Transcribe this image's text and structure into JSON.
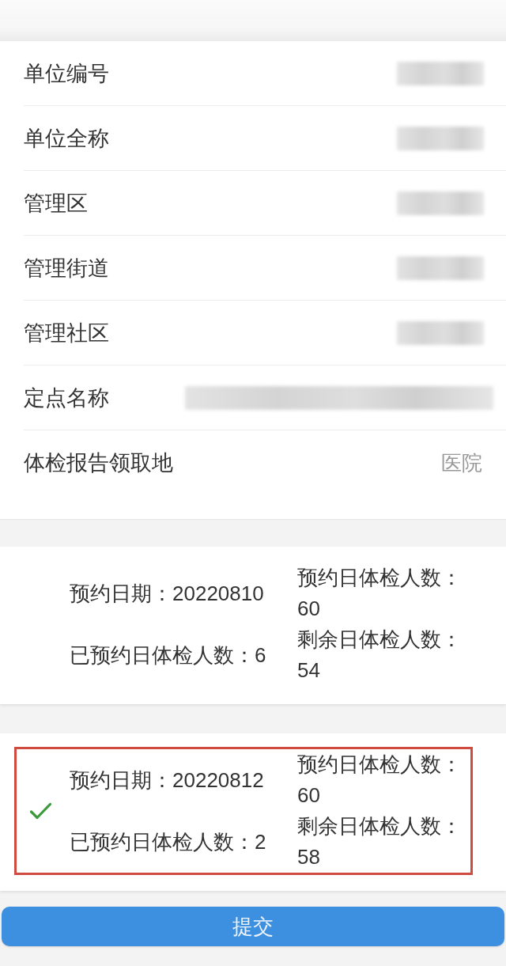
{
  "form": {
    "rows": [
      {
        "label": "单位编号",
        "kind": "redacted"
      },
      {
        "label": "单位全称",
        "kind": "redacted"
      },
      {
        "label": "管理区",
        "kind": "redacted"
      },
      {
        "label": "管理街道",
        "kind": "redacted"
      },
      {
        "label": "管理社区",
        "kind": "redacted"
      },
      {
        "label": "定点名称",
        "kind": "redacted_wide"
      },
      {
        "label": "体检报告领取地",
        "kind": "text",
        "value": "医院"
      }
    ]
  },
  "slots": [
    {
      "selected": false,
      "date": "预约日期：20220810",
      "booked": "已预约日体检人数：6",
      "capacity": "预约日体检人数：60",
      "remaining": "剩余日体检人数：54"
    },
    {
      "selected": true,
      "date": "预约日期：20220812",
      "booked": "已预约日体检人数：2",
      "capacity": "预约日体检人数：60",
      "remaining": "剩余日体检人数：58"
    }
  ],
  "submit_button": {
    "label": "提交"
  }
}
